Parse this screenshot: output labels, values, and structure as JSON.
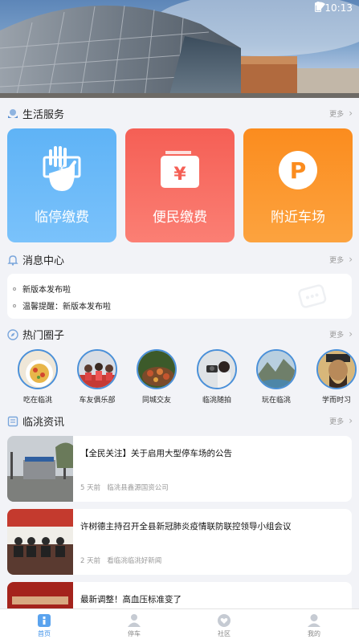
{
  "status_bar": {
    "time": "10:13"
  },
  "life_services": {
    "title": "生活服务",
    "more": "更多",
    "cards": [
      {
        "label": "临停缴费",
        "icon": "hand-money-icon"
      },
      {
        "label": "便民缴费",
        "icon": "wallet-yen-icon"
      },
      {
        "label": "附近车场",
        "icon": "parking-p-icon"
      }
    ]
  },
  "messages": {
    "title": "消息中心",
    "more": "更多",
    "items": [
      "新版本发布啦",
      "温馨提醒：新版本发布啦"
    ]
  },
  "circles": {
    "title": "热门圈子",
    "more": "更多",
    "items": [
      "吃在临洮",
      "车友俱乐部",
      "同城交友",
      "临洮随拍",
      "玩在临洮",
      "学而时习"
    ]
  },
  "news": {
    "title": "临洮资讯",
    "more": "更多",
    "items": [
      {
        "title": "【全民关注】关于启用大型停车场的公告",
        "time": "5 天前",
        "source": "临洮县鑫源国资公司"
      },
      {
        "title": "许树德主持召开全县新冠肺炎疫情联防联控领导小组会议",
        "time": "2 天前",
        "source": "看临洮临洮好新闻"
      },
      {
        "title": "最新调整！高血压标准变了",
        "time": "",
        "source": ""
      }
    ]
  },
  "tabbar": {
    "items": [
      {
        "label": "首页",
        "active": true
      },
      {
        "label": "停车",
        "active": false
      },
      {
        "label": "社区",
        "active": false
      },
      {
        "label": "我的",
        "active": false
      }
    ]
  },
  "colors": {
    "accent": "#3b8fe8",
    "card_blue": "#6ab9f8",
    "card_red": "#f8695e",
    "card_orange": "#fb9630"
  }
}
